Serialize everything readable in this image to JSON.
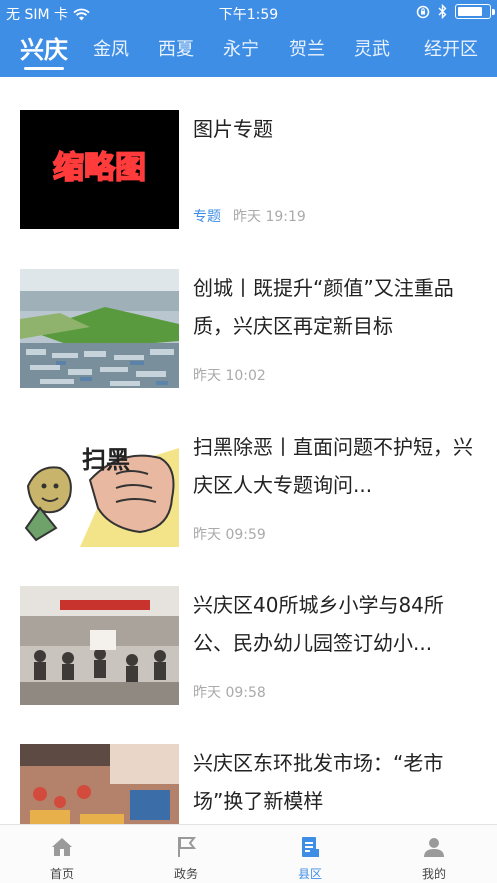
{
  "status_bar": {
    "carrier": "无 SIM 卡",
    "time": "下午1:59",
    "battery_level": 0.8
  },
  "tabs": [
    {
      "label": "兴庆",
      "active": true
    },
    {
      "label": "金凤",
      "active": false
    },
    {
      "label": "西夏",
      "active": false
    },
    {
      "label": "永宁",
      "active": false
    },
    {
      "label": "贺兰",
      "active": false
    },
    {
      "label": "灵武",
      "active": false
    },
    {
      "label": "经开区",
      "active": false
    }
  ],
  "articles": [
    {
      "title": "图片专题",
      "tag": "专题",
      "time": "昨天 19:19",
      "thumb_text": "缩略图"
    },
    {
      "title": "创城丨既提升“颜值”又注重品质，兴庆区再定新目标",
      "time": "昨天 10:02"
    },
    {
      "title": "扫黑除恶丨直面问题不护短，兴庆区人大专题询问...",
      "time": "昨天 09:59",
      "thumb_text": "扫黑"
    },
    {
      "title": "兴庆区40所城乡小学与84所公、民办幼儿园签订幼小...",
      "time": "昨天 09:58"
    },
    {
      "title": "兴庆区东环批发市场：“老市场”换了新模样"
    }
  ],
  "bottom_nav": [
    {
      "label": "首页",
      "icon": "home-icon"
    },
    {
      "label": "政务",
      "icon": "flag-icon"
    },
    {
      "label": "县区",
      "icon": "document-icon",
      "active": true
    },
    {
      "label": "我的",
      "icon": "user-icon"
    }
  ],
  "colors": {
    "accent": "#3f8ee6",
    "header_bg": "#3f8ee6"
  }
}
